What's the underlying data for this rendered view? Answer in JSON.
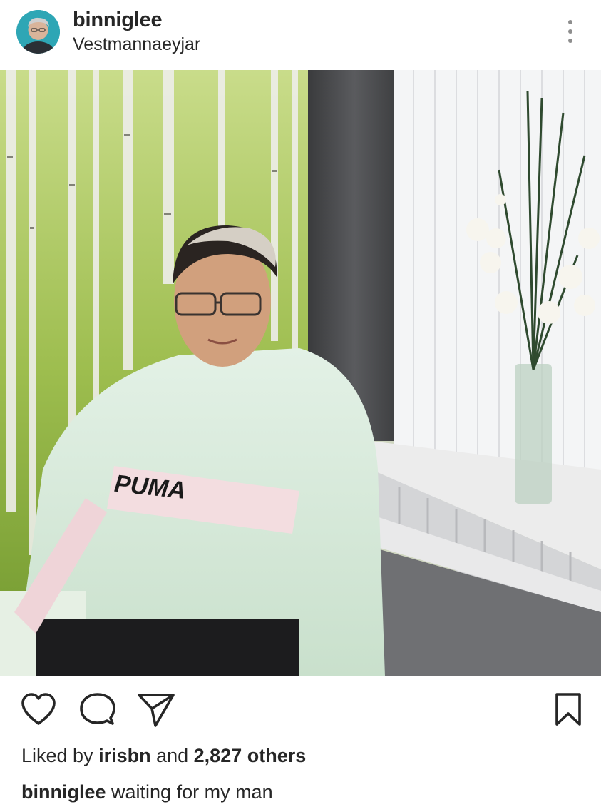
{
  "header": {
    "username": "binniglee",
    "location": "Vestmannaeyjar",
    "avatar_icon": "avatar",
    "more_icon": "more-options-icon"
  },
  "photo": {
    "shirt_brand_text": "PUMA"
  },
  "actions": {
    "like_icon": "heart-icon",
    "comment_icon": "comment-icon",
    "share_icon": "send-icon",
    "save_icon": "bookmark-icon"
  },
  "likes": {
    "prefix": "Liked by ",
    "user": "irisbn",
    "middle": " and ",
    "count": "2,827 others"
  },
  "caption": {
    "username": "binniglee",
    "text": " waiting for my man"
  },
  "colors": {
    "text": "#262626",
    "icon_gray": "#8e8e8e",
    "avatar_bg": "#2ea6b5"
  }
}
